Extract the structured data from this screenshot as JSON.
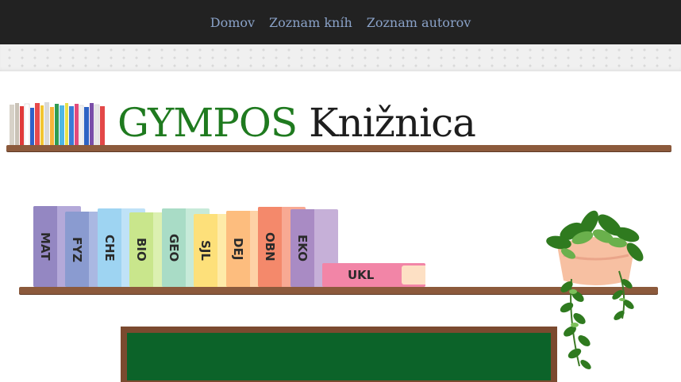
{
  "nav": {
    "items": [
      {
        "label": "Domov"
      },
      {
        "label": "Zoznam kníh"
      },
      {
        "label": "Zoznam autorov"
      }
    ]
  },
  "header": {
    "title_brand": "GYMPOS",
    "title_rest": "Knižnica"
  },
  "shelf": {
    "books": [
      {
        "label": "MAT",
        "color": "#9487c2",
        "light": "#b4a9d9"
      },
      {
        "label": "FYZ",
        "color": "#8a9bd0",
        "light": "#aab8e2"
      },
      {
        "label": "CHE",
        "color": "#9ed4f2",
        "light": "#bfe2f7"
      },
      {
        "label": "BIO",
        "color": "#c9e68c",
        "light": "#dcf0b1"
      },
      {
        "label": "GEO",
        "color": "#a9dcc6",
        "light": "#c7ead9"
      },
      {
        "label": "SJL",
        "color": "#fde07a",
        "light": "#feeba8"
      },
      {
        "label": "DEJ",
        "color": "#fdbd7e",
        "light": "#fed2a6"
      },
      {
        "label": "OBN",
        "color": "#f4896b",
        "light": "#f8a993"
      },
      {
        "label": "EKO",
        "color": "#a98bc4",
        "light": "#c6b0d8"
      }
    ],
    "flat_book": {
      "label": "UKL",
      "color": "#f285a7"
    }
  },
  "colors": {
    "nav_bg": "#222222",
    "nav_link": "#8aa2c8",
    "brand_green": "#1f7a1f",
    "shelf_wood": "#8c5a3c",
    "board_green": "#0c6329"
  }
}
